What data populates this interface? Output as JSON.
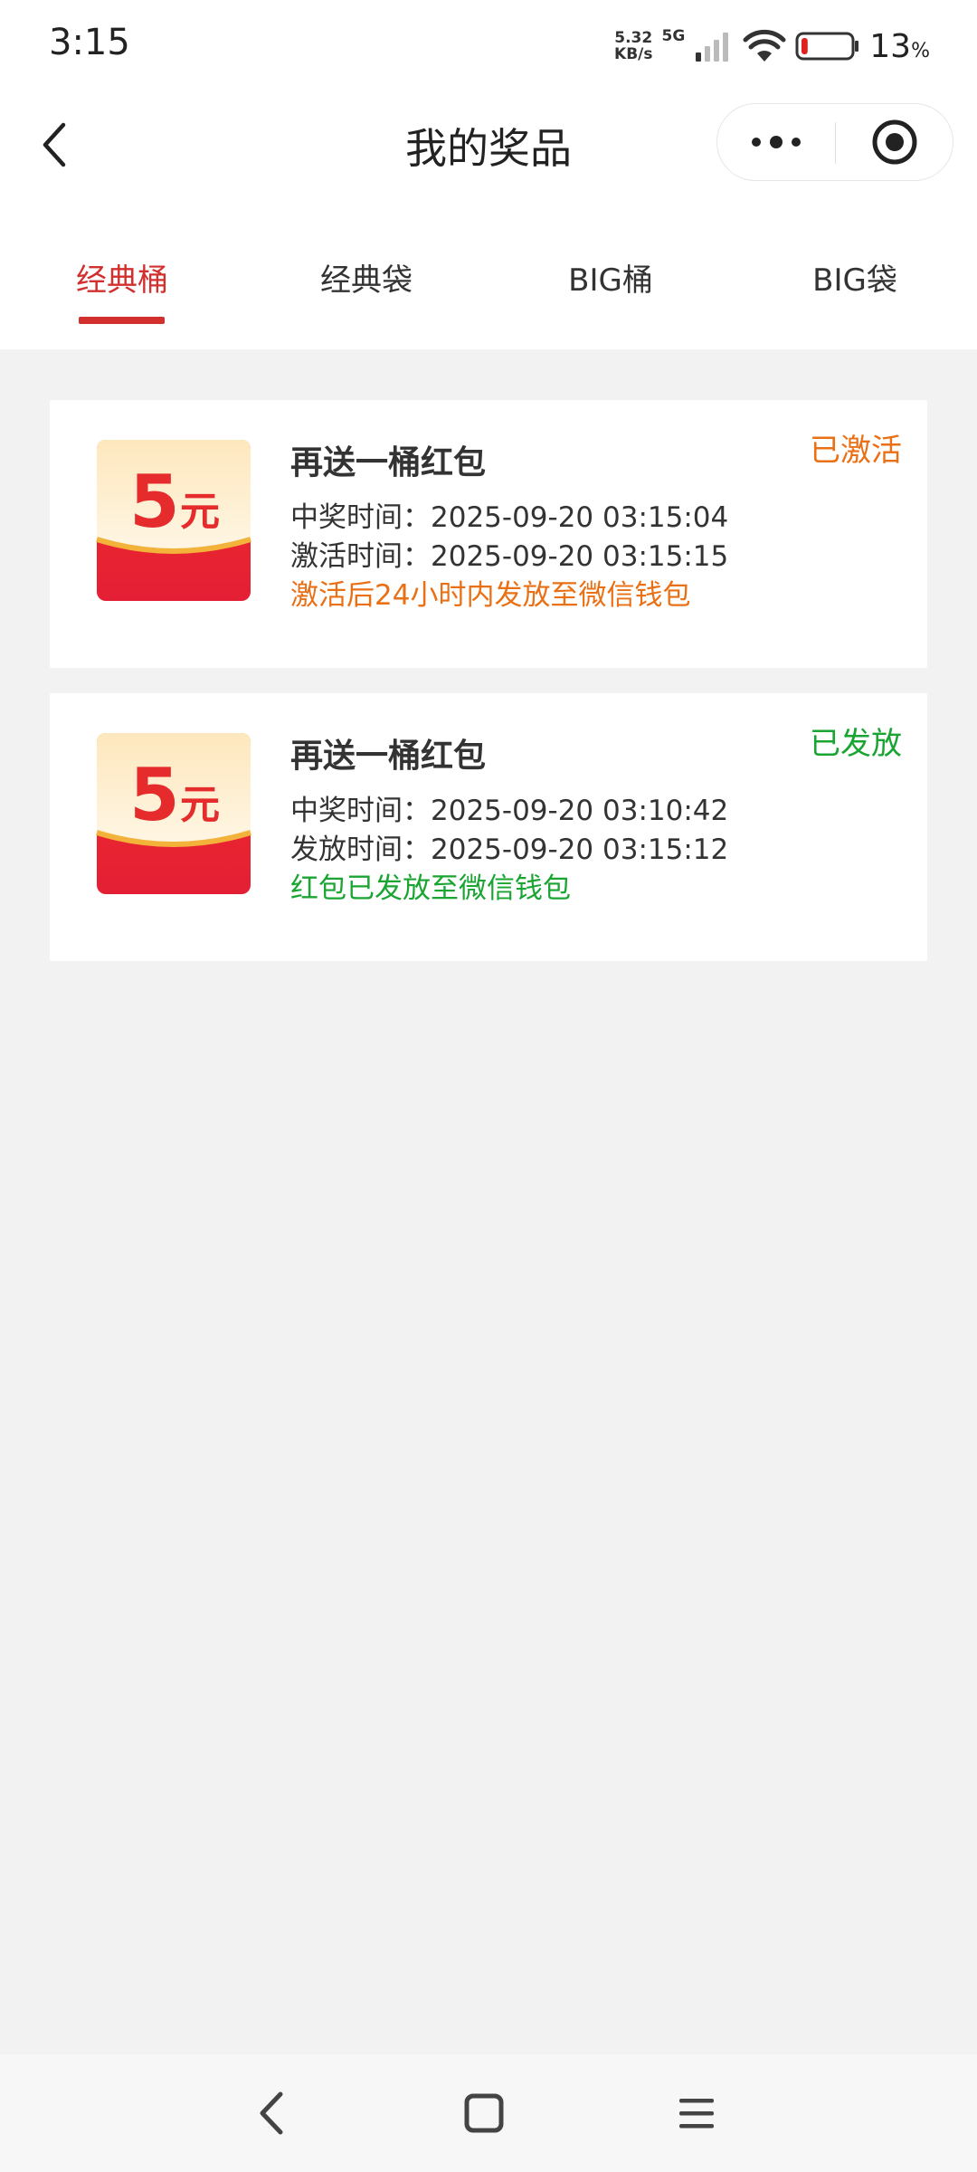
{
  "status_bar": {
    "time": "3:15",
    "speed_value": "5.32",
    "speed_unit": "KB/s",
    "network": "5G",
    "battery_pct": "13",
    "battery_unit": "%",
    "battery_level": 0.13,
    "battery_color": "#e02020"
  },
  "nav": {
    "title": "我的奖品",
    "back_icon": "chevron-left-icon",
    "more_icon": "more-dots-icon",
    "close_icon": "target-circle-icon"
  },
  "tabs": [
    {
      "label": "经典桶",
      "active": true
    },
    {
      "label": "经典袋",
      "active": false
    },
    {
      "label": "BIG桶",
      "active": false
    },
    {
      "label": "BIG袋",
      "active": false
    }
  ],
  "accent_color": "#d2302f",
  "prizes": [
    {
      "thumb_amount": "5",
      "thumb_unit": "元",
      "title": "再送一桶红包",
      "status": "已激活",
      "status_color": "#ea7016",
      "line1_label": "中奖时间：",
      "line1_value": "2025-09-20 03:15:04",
      "line2_label": "激活时间：",
      "line2_value": "2025-09-20 03:15:15",
      "note": "激活后24小时内发放至微信钱包",
      "note_color": "#ea7016"
    },
    {
      "thumb_amount": "5",
      "thumb_unit": "元",
      "title": "再送一桶红包",
      "status": "已发放",
      "status_color": "#1aa533",
      "line1_label": "中奖时间：",
      "line1_value": "2025-09-20 03:10:42",
      "line2_label": "发放时间：",
      "line2_value": "2025-09-20 03:15:12",
      "note": "红包已发放至微信钱包",
      "note_color": "#1aa533"
    }
  ],
  "system_nav": {
    "back_icon": "back-triangle-icon",
    "home_icon": "home-square-icon",
    "menu_icon": "menu-lines-icon"
  }
}
